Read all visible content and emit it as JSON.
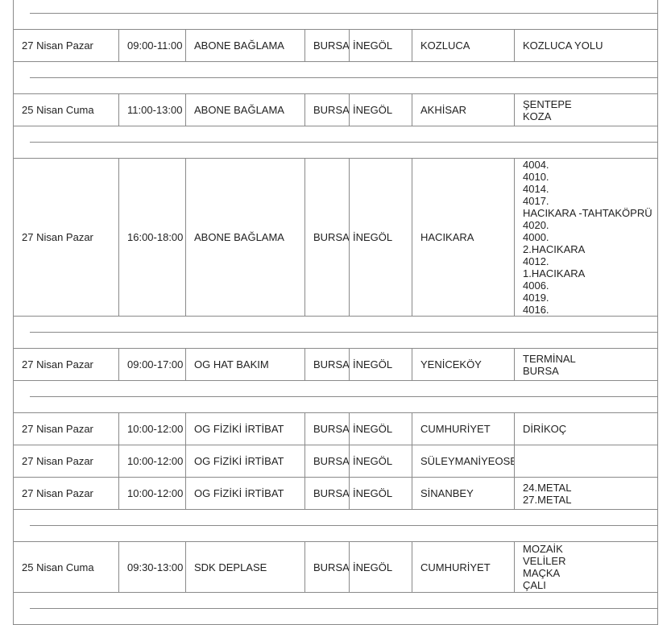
{
  "rows": [
    {
      "date": "27 Nisan Pazar",
      "time": "09:00-11:00",
      "type": "ABONE BAĞLAMA",
      "province": "BURSA",
      "district": "İNEGÖL",
      "neighborhood": "KOZLUCA",
      "streets": [
        "KOZLUCA YOLU"
      ]
    },
    {
      "date": "25 Nisan Cuma",
      "time": "11:00-13:00",
      "type": "ABONE BAĞLAMA",
      "province": "BURSA",
      "district": "İNEGÖL",
      "neighborhood": "AKHİSAR",
      "streets": [
        "ŞENTEPE",
        "KOZA"
      ]
    },
    {
      "date": "27 Nisan Pazar",
      "time": "16:00-18:00",
      "type": "ABONE BAĞLAMA",
      "province": "BURSA",
      "district": "İNEGÖL",
      "neighborhood": "HACIKARA",
      "streets": [
        "4004.",
        "4010.",
        "4014.",
        "4017.",
        "HACIKARA -TAHTAKÖPRÜ",
        "4020.",
        "4000.",
        "2.HACIKARA",
        "4012.",
        "1.HACIKARA",
        "4006.",
        "4019.",
        "4016."
      ]
    },
    {
      "date": "27 Nisan Pazar",
      "time": "09:00-17:00",
      "type": "OG HAT BAKIM",
      "province": "BURSA",
      "district": "İNEGÖL",
      "neighborhood": "YENİCEKÖY",
      "streets": [
        "TERMİNAL",
        "BURSA"
      ]
    },
    {
      "date": "27 Nisan Pazar",
      "time": "10:00-12:00",
      "type": "OG FİZİKİ İRTİBAT",
      "province": "BURSA",
      "district": "İNEGÖL",
      "neighborhood": "CUMHURİYET",
      "streets": [
        "DİRİKOÇ"
      ]
    },
    {
      "date": "27 Nisan Pazar",
      "time": "10:00-12:00",
      "type": "OG FİZİKİ İRTİBAT",
      "province": "BURSA",
      "district": "İNEGÖL",
      "neighborhood": "SÜLEYMANİYEOSB",
      "streets": []
    },
    {
      "date": "27 Nisan Pazar",
      "time": "10:00-12:00",
      "type": "OG FİZİKİ İRTİBAT",
      "province": "BURSA",
      "district": "İNEGÖL",
      "neighborhood": "SİNANBEY",
      "streets": [
        "24.METAL",
        "27.METAL"
      ]
    },
    {
      "date": "25 Nisan Cuma",
      "time": "09:30-13:00",
      "type": "SDK DEPLASE",
      "province": "BURSA",
      "district": "İNEGÖL",
      "neighborhood": "CUMHURİYET",
      "streets": [
        "MOZAİK",
        "VELİLER",
        "MAÇKA",
        "ÇALI"
      ]
    }
  ]
}
